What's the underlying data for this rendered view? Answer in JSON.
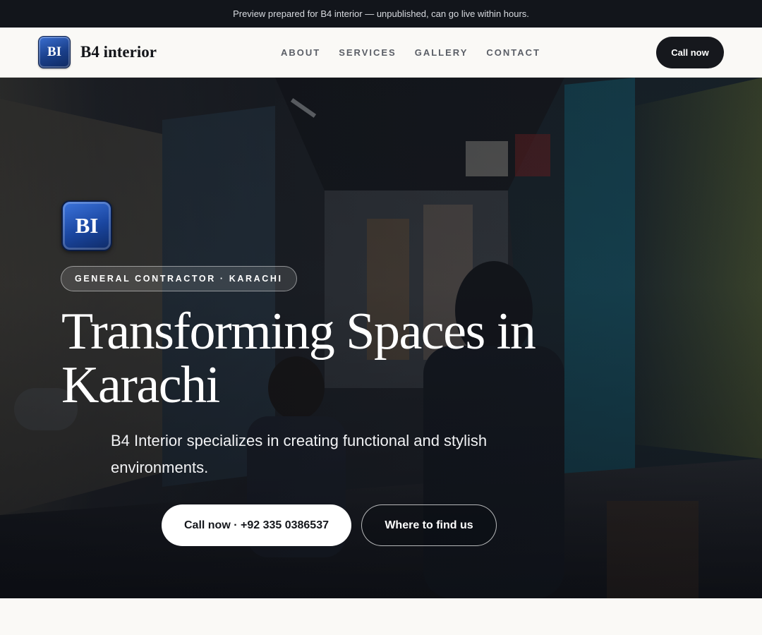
{
  "preview_bar": {
    "text": "Preview prepared for B4 interior — unpublished, can go live within hours."
  },
  "header": {
    "logo_text": "BI",
    "brand_name": "B4 interior",
    "nav": [
      {
        "label": "ABOUT"
      },
      {
        "label": "SERVICES"
      },
      {
        "label": "GALLERY"
      },
      {
        "label": "CONTACT"
      }
    ],
    "cta_label": "Call now"
  },
  "hero": {
    "logo_text": "BI",
    "tag": "GENERAL CONTRACTOR · KARACHI",
    "title": "Transforming Spaces in Karachi",
    "subtitle": "B4 Interior specializes in creating functional and stylish environments.",
    "primary_cta": "Call now · +92 335 0386537",
    "secondary_cta": "Where to find us",
    "background_image": "market-alley-photo"
  },
  "colors": {
    "preview_bar_bg": "#12151b",
    "header_bg": "#faf9f6",
    "dark_button": "#16181d",
    "logo_blue": "#1a46a0"
  }
}
